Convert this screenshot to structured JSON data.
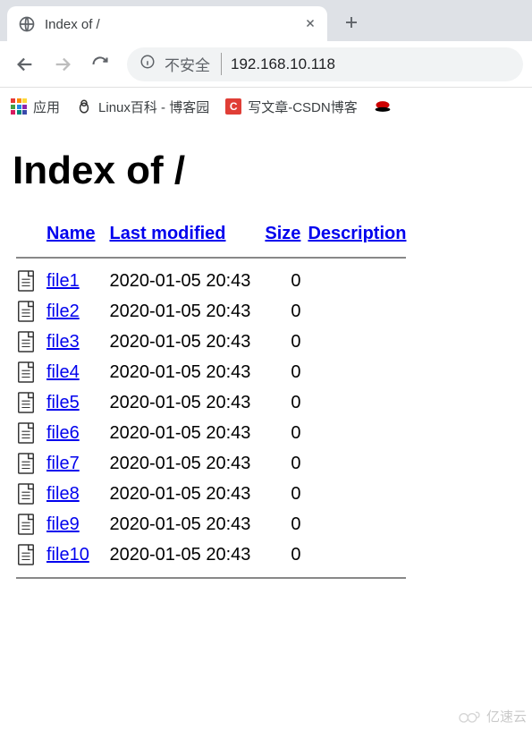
{
  "browser": {
    "tab_title": "Index of /",
    "insecure_label": "不安全",
    "url": "192.168.10.118"
  },
  "bookmarks": {
    "apps_label": "应用",
    "items": [
      {
        "label": "Linux百科 - 博客园"
      },
      {
        "label": "写文章-CSDN博客"
      }
    ]
  },
  "page": {
    "heading": "Index of /",
    "columns": {
      "name": "Name",
      "last_modified": "Last modified",
      "size": "Size",
      "description": "Description"
    },
    "files": [
      {
        "name": "file1",
        "modified": "2020-01-05 20:43",
        "size": "0"
      },
      {
        "name": "file2",
        "modified": "2020-01-05 20:43",
        "size": "0"
      },
      {
        "name": "file3",
        "modified": "2020-01-05 20:43",
        "size": "0"
      },
      {
        "name": "file4",
        "modified": "2020-01-05 20:43",
        "size": "0"
      },
      {
        "name": "file5",
        "modified": "2020-01-05 20:43",
        "size": "0"
      },
      {
        "name": "file6",
        "modified": "2020-01-05 20:43",
        "size": "0"
      },
      {
        "name": "file7",
        "modified": "2020-01-05 20:43",
        "size": "0"
      },
      {
        "name": "file8",
        "modified": "2020-01-05 20:43",
        "size": "0"
      },
      {
        "name": "file9",
        "modified": "2020-01-05 20:43",
        "size": "0"
      },
      {
        "name": "file10",
        "modified": "2020-01-05 20:43",
        "size": "0"
      }
    ]
  },
  "watermark": "亿速云"
}
